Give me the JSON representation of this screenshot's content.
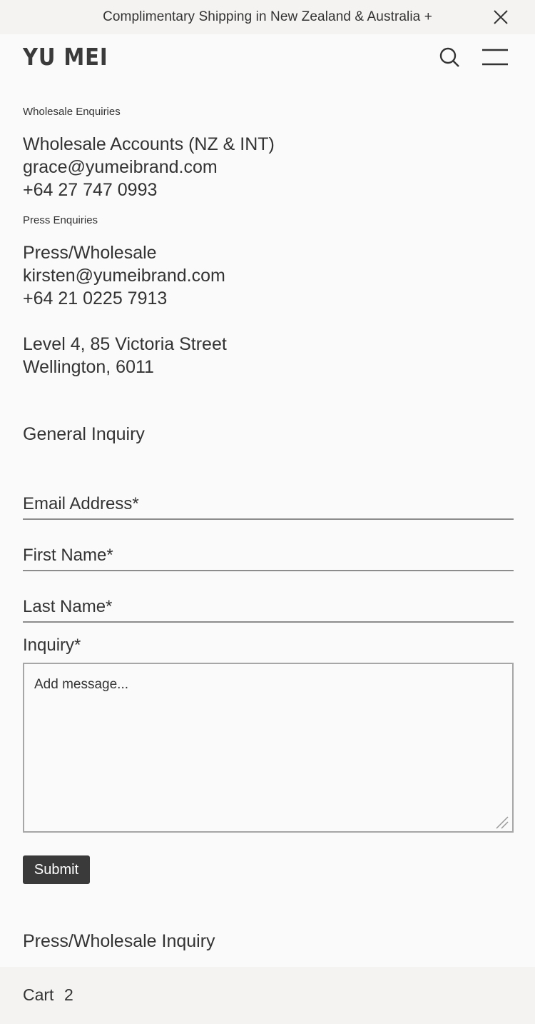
{
  "announcement": {
    "text": "Complimentary Shipping in New Zealand & Australia +",
    "close_icon": "close-icon"
  },
  "header": {
    "logo": "YU MEI",
    "search_icon": "search-icon",
    "menu_icon": "hamburger-menu-icon"
  },
  "contacts": {
    "wholesale": {
      "heading": "Wholesale Enquiries",
      "lines": [
        "Wholesale Accounts (NZ & INT)",
        "grace@yumeibrand.com",
        "+64 27 747 0993"
      ]
    },
    "press": {
      "heading": "Press Enquiries",
      "lines": [
        "Press/Wholesale",
        "kirsten@yumeibrand.com",
        "+64 21 0225 7913"
      ]
    },
    "address": {
      "lines": [
        "Level 4, 85 Victoria Street",
        "Wellington, 6011"
      ]
    }
  },
  "general_form": {
    "title": "General Inquiry",
    "fields": [
      {
        "label": "Email Address*"
      },
      {
        "label": "First Name*"
      },
      {
        "label": "Last Name*"
      }
    ],
    "inquiry_label": "Inquiry*",
    "message_placeholder": "Add message...",
    "submit_label": "Submit"
  },
  "press_form": {
    "title": "Press/Wholesale Inquiry"
  },
  "cart": {
    "label": "Cart",
    "count": "2"
  },
  "colors": {
    "background": "#fafafa",
    "bar_background": "#f4f3f1",
    "text": "#333333",
    "button": "#3a3a3a"
  }
}
